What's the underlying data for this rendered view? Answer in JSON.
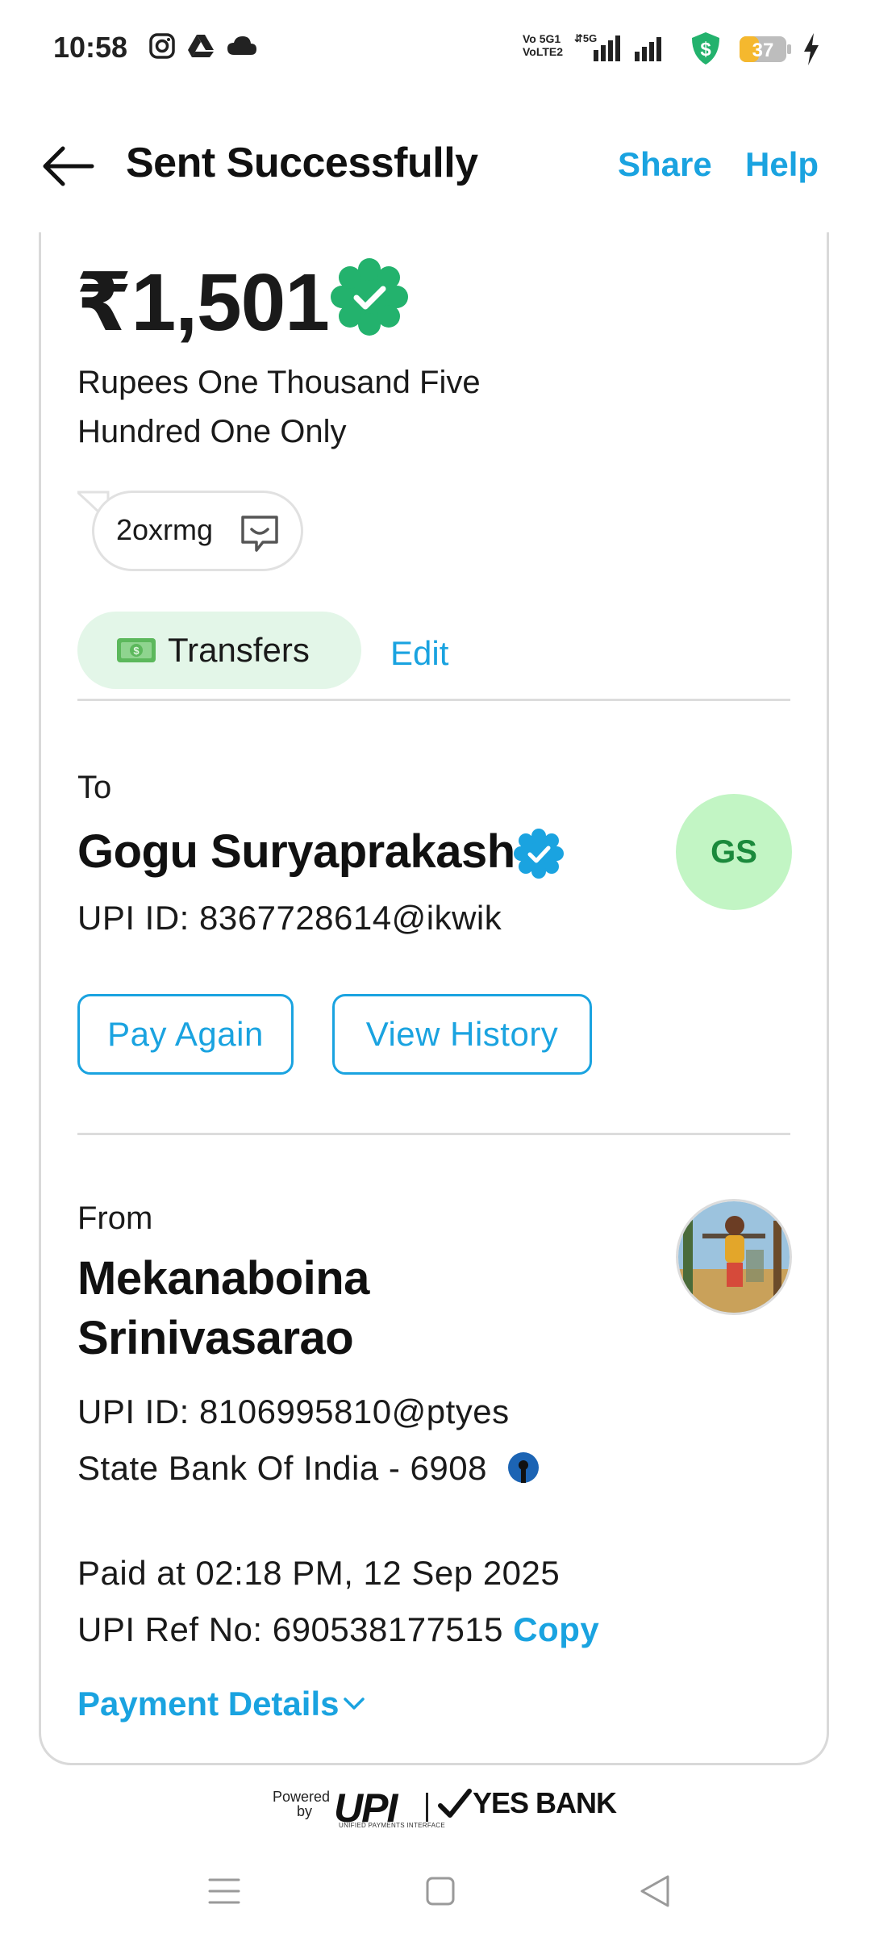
{
  "status_bar": {
    "time": "10:58",
    "battery": "37",
    "network": "Vo 5G1 VoLTE2 5G",
    "icons": [
      "instagram-icon",
      "drive-icon",
      "cloud-icon",
      "signal-icon",
      "wallet-shield-icon",
      "battery-icon",
      "charging-icon"
    ]
  },
  "header": {
    "title": "Sent Successfully",
    "share_label": "Share",
    "help_label": "Help"
  },
  "transaction": {
    "amount": "₹1,501",
    "amount_words": "Rupees One Thousand Five Hundred One Only",
    "note": "2oxrmg",
    "category": "Transfers",
    "edit_label": "Edit"
  },
  "to": {
    "label": "To",
    "name": "Gogu Suryaprakash",
    "upi_id": "UPI ID: 8367728614@ikwik",
    "initials": "GS",
    "pay_again_label": "Pay Again",
    "view_history_label": "View History"
  },
  "from": {
    "label": "From",
    "name": "Mekanaboina Srinivasarao",
    "upi_id": "UPI ID: 8106995810@ptyes",
    "bank": "State Bank Of India - 6908"
  },
  "details": {
    "paid_at": "Paid at 02:18 PM, 12 Sep 2025",
    "ref_no": "UPI Ref No: 690538177515",
    "copy_label": "Copy",
    "payment_details_label": "Payment Details"
  },
  "footer": {
    "powered_line1": "Powered",
    "powered_line2": "by",
    "upi": "UPI",
    "upi_sub": "UNIFIED PAYMENTS INTERFACE",
    "bank": "YES BANK"
  },
  "colors": {
    "accent": "#1aa3e0",
    "success": "#23b26d",
    "chip_green": "#e3f6e8",
    "avatar_green": "#c2f5c4"
  }
}
